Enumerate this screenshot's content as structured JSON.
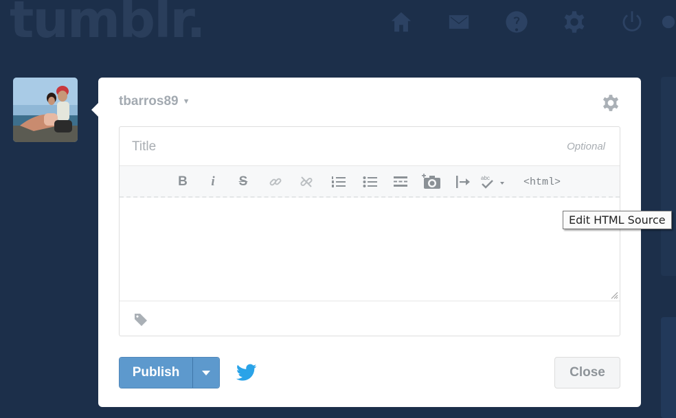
{
  "brand": {
    "logo_text": "tumblr."
  },
  "nav": {
    "items": [
      {
        "name": "home-icon"
      },
      {
        "name": "mail-icon"
      },
      {
        "name": "help-icon"
      },
      {
        "name": "gear-icon"
      },
      {
        "name": "power-icon"
      }
    ]
  },
  "post": {
    "blog_name": "tbarros89",
    "title_placeholder": "Title",
    "title_value": "",
    "optional_label": "Optional",
    "toolbar": {
      "bold": "B",
      "italic": "i",
      "strike": "S",
      "html": "<html>"
    },
    "tooltip": "Edit HTML Source",
    "publish_label": "Publish",
    "close_label": "Close"
  },
  "colors": {
    "background": "#1c2f4a",
    "accent": "#5d99cd",
    "twitter": "#2aa3e8"
  }
}
